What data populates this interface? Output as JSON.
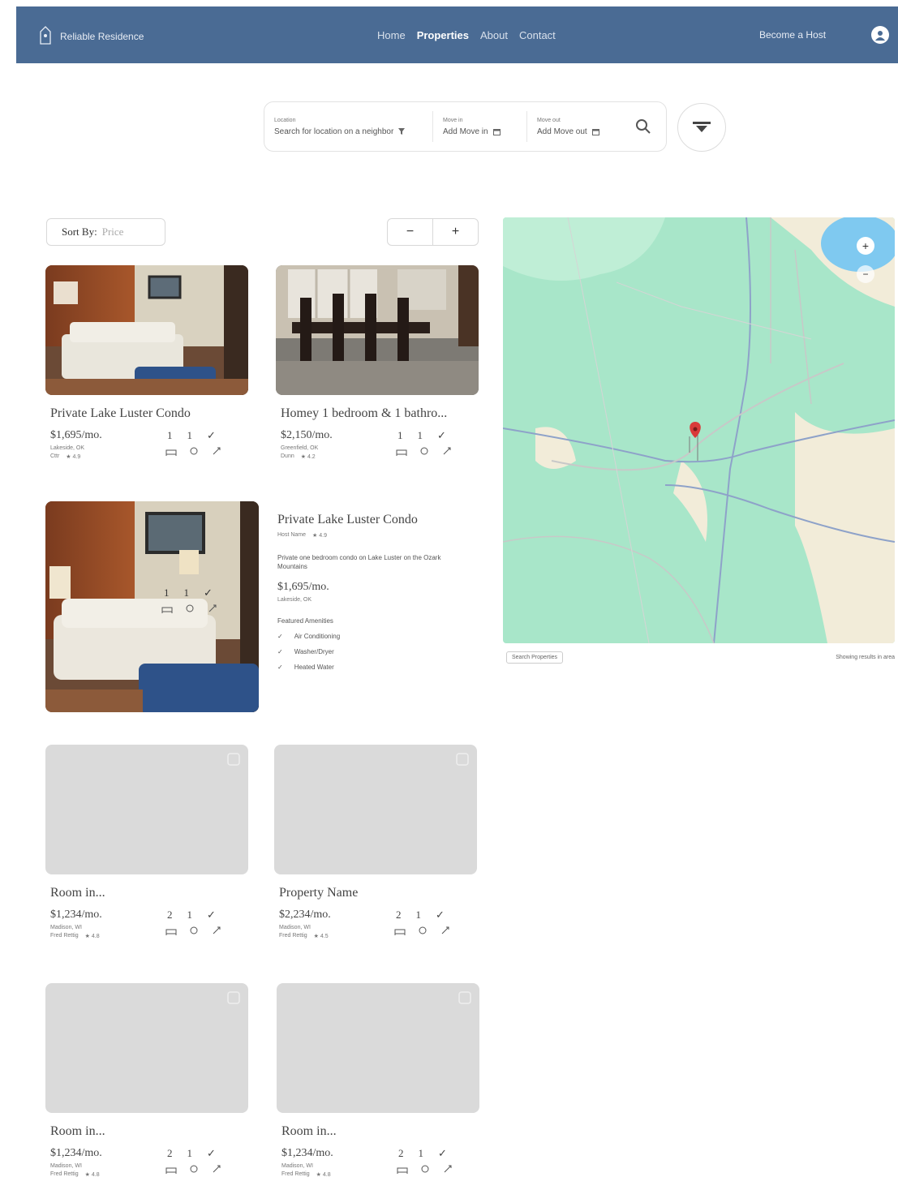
{
  "header": {
    "brand": "Reliable Residence",
    "nav": [
      "Home",
      "Properties",
      "About",
      "Contact"
    ],
    "active_nav": "Properties",
    "host_link": "Become a Host"
  },
  "search": {
    "location_label": "Location",
    "location_value": "Search for location on a neighbor",
    "movein_label": "Move in",
    "movein_value": "Add Move in",
    "moveout_label": "Move out",
    "moveout_value": "Add Move out"
  },
  "list": {
    "sort_label": "Sort By:",
    "sort_value": "Price",
    "minus": "−",
    "plus": "+"
  },
  "cards": [
    {
      "title": "Private Lake Luster Condo",
      "price": "$1,695/mo.",
      "loc": "Lakeside, OK",
      "type": "Cttr",
      "rating": "4.9",
      "beds": "1",
      "baths": "1"
    },
    {
      "title": "Homey 1 bedroom & 1 bathro...",
      "price": "$2,150/mo.",
      "loc": "Greenfield, OK",
      "type": "Dunn",
      "rating": "4.2",
      "beds": "1",
      "baths": "1"
    },
    {
      "title": "Room in...",
      "price": "$1,234/mo.",
      "loc": "Madison, WI",
      "type": "Fred Rettig",
      "rating": "4.8",
      "beds": "2",
      "baths": "1"
    },
    {
      "title": "Property Name",
      "price": "$2,234/mo.",
      "loc": "Madison, WI",
      "type": "Fred Rettig",
      "rating": "4.5",
      "beds": "2",
      "baths": "1"
    },
    {
      "title": "Room in...",
      "price": "$1,234/mo.",
      "loc": "Madison, WI",
      "type": "Fred Rettig",
      "rating": "4.8",
      "beds": "2",
      "baths": "1"
    },
    {
      "title": "Room in...",
      "price": "$1,234/mo.",
      "loc": "Madison, WI",
      "type": "Fred Rettig",
      "rating": "4.8",
      "beds": "2",
      "baths": "1"
    }
  ],
  "featured": {
    "title": "Private Lake Luster Condo",
    "sub": "Host Name",
    "rating": "4.9",
    "desc": "Private one bedroom condo on Lake Luster on the Ozark Mountains",
    "price": "$1,695/mo.",
    "loc": "Lakeside, OK",
    "beds": "1",
    "baths": "1",
    "amenities_heading": "Featured Amenities",
    "amenities": [
      "Air Conditioning",
      "Washer/Dryer",
      "Heated Water"
    ]
  },
  "map": {
    "filter": "Search Properties",
    "count": "Showing results in area"
  },
  "colors": {
    "header": "#4a6b94",
    "map_land": "#a8e6c9",
    "map_water": "#7fc9f0",
    "pin": "#d93a3a"
  }
}
